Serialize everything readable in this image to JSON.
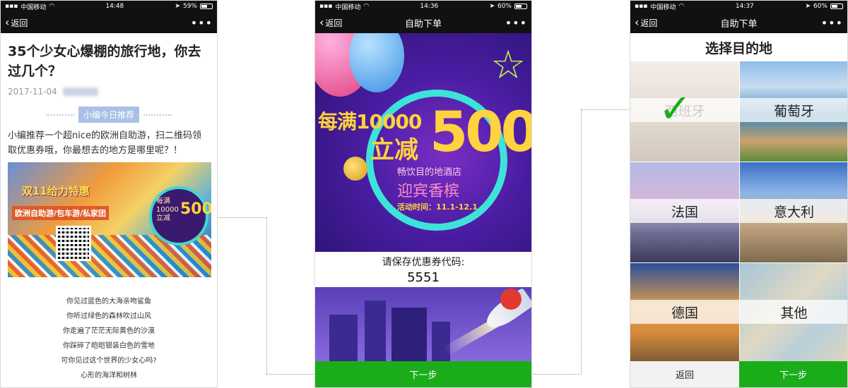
{
  "phone1": {
    "status": {
      "carrier": "中国移动",
      "time": "14:48",
      "battery": "59%",
      "battery_level": 0.59
    },
    "nav": {
      "back_label": "返回",
      "more": "•••"
    },
    "article": {
      "title": "35个少女心爆棚的旅行地，你去过几个？",
      "date": "2017-11-04",
      "tag": "小编今日推荐",
      "intro": "小编推荐一个超nice的欧洲自助游，扫二维码领取优惠券哦，你最想去的地方是哪里呢？！",
      "banner": {
        "headline": "双11给力特惠",
        "subline": "欧洲自助游/包车游/私家团",
        "circle_text": "每满10000 立减",
        "circle_amount": "500"
      },
      "poem_lines": [
        "你见过蓝色的大海亲吻鲨鱼",
        "你听过绿色的森林吹过山风",
        "你走遍了茫茫无际黄色的沙漠",
        "你踩碎了皑皑银装白色的雪地",
        "可你见过这个世界的少女心吗?",
        "心形的海洋和树林"
      ]
    }
  },
  "phone2": {
    "status": {
      "carrier": "中国移动",
      "time": "14:36",
      "battery": "60%",
      "battery_level": 0.6
    },
    "nav": {
      "back_label": "返回",
      "title": "自助下单",
      "more": "•••"
    },
    "promo": {
      "line1": "每满10000",
      "line2": "立减",
      "amount": "500",
      "sub1": "畅饮目的地酒店",
      "sub2": "迎宾香槟",
      "date": "活动时间：11.1-12.1"
    },
    "coupon": {
      "label": "请保存优惠券代码:",
      "code": "5551"
    },
    "next_label": "下一步"
  },
  "phone3": {
    "status": {
      "carrier": "中国移动",
      "time": "14:37",
      "battery": "60%",
      "battery_level": 0.6
    },
    "nav": {
      "back_label": "返回",
      "title": "自助下单",
      "more": "•••"
    },
    "picker_title": "选择目的地",
    "destinations": [
      {
        "label": "西班牙",
        "selected": true
      },
      {
        "label": "葡萄牙",
        "selected": false
      },
      {
        "label": "法国",
        "selected": false
      },
      {
        "label": "意大利",
        "selected": false
      },
      {
        "label": "德国",
        "selected": false
      },
      {
        "label": "其他",
        "selected": false
      }
    ],
    "back_label": "返回",
    "next_label": "下一步"
  },
  "colors": {
    "accent_green": "#1aad19",
    "nav_bg": "#111111",
    "tag_blue": "#a9c1e6"
  }
}
